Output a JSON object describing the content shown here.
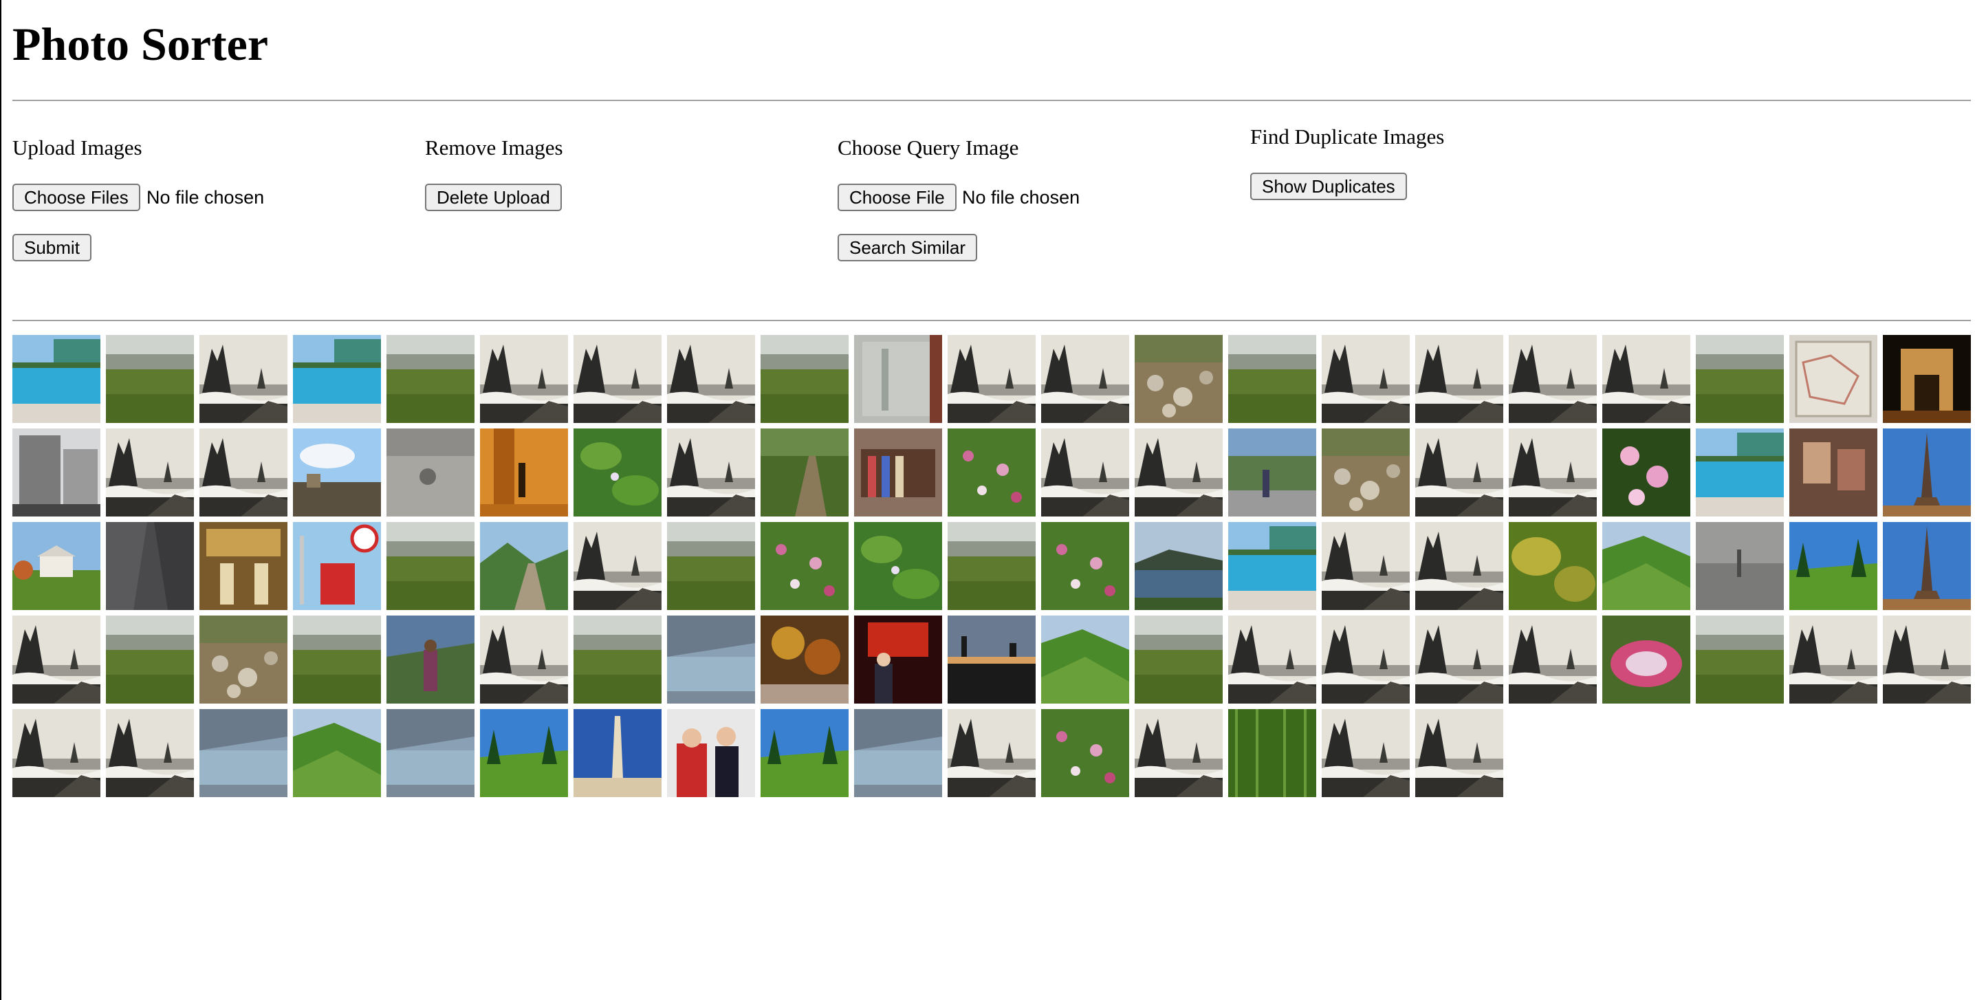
{
  "app": {
    "title": "Photo Sorter"
  },
  "upload": {
    "label": "Upload Images",
    "choose_label": "Choose Files",
    "file_status": "No file chosen",
    "submit_label": "Submit"
  },
  "remove": {
    "label": "Remove Images",
    "delete_label": "Delete Upload"
  },
  "query": {
    "label": "Choose Query Image",
    "choose_label": "Choose File",
    "file_status": "No file chosen",
    "search_label": "Search Similar"
  },
  "duplicates": {
    "label": "Find Duplicate Images",
    "show_label": "Show Duplicates"
  },
  "gallery": {
    "thumbnails": [
      "pool",
      "meadow",
      "sea-stacks",
      "pool",
      "meadow",
      "sea-stacks",
      "sea-stacks",
      "sea-stacks",
      "meadow",
      "window",
      "sea-stacks",
      "sea-stacks",
      "rocky-stream",
      "meadow",
      "sea-stacks",
      "sea-stacks",
      "sea-stacks",
      "sea-stacks",
      "meadow",
      "map",
      "arch-night",
      "city-building",
      "sea-stacks",
      "sea-stacks",
      "city-sky",
      "rocky-path",
      "night-street",
      "foliage",
      "sea-stacks",
      "garden-path",
      "clothes-rack",
      "flower-garden",
      "sea-stacks",
      "sea-stacks",
      "street-view",
      "rocky-stream",
      "sea-stacks",
      "sea-stacks",
      "pink-flowers",
      "pool",
      "interior-room",
      "eiffel-tower",
      "gazebo",
      "rock-wall",
      "palace-hall",
      "speed-sign",
      "meadow",
      "mountain-valley",
      "sea-stacks",
      "meadow",
      "flower-garden",
      "foliage",
      "meadow",
      "flower-garden",
      "lake",
      "pool",
      "sea-stacks",
      "sea-stacks",
      "yellow-shrubs",
      "green-hills",
      "gray-ground",
      "alpine-forest",
      "eiffel-tower",
      "sea-stacks",
      "meadow",
      "rocky-stream",
      "meadow",
      "hiker",
      "sea-stacks",
      "meadow",
      "fjord-water",
      "autumn-trees",
      "people-red",
      "dusk-skyline",
      "green-hills",
      "meadow",
      "sea-stacks",
      "sea-stacks",
      "sea-stacks",
      "sea-stacks",
      "flower-bed",
      "meadow",
      "sea-stacks",
      "sea-stacks",
      "sea-stacks",
      "sea-stacks",
      "fjord-water",
      "green-hills",
      "fjord-water",
      "alpine-forest",
      "monument",
      "people-plane",
      "alpine-forest",
      "fjord-water",
      "sea-stacks",
      "flower-garden",
      "sea-stacks",
      "tall-grass",
      "sea-stacks",
      "sea-stacks"
    ]
  }
}
